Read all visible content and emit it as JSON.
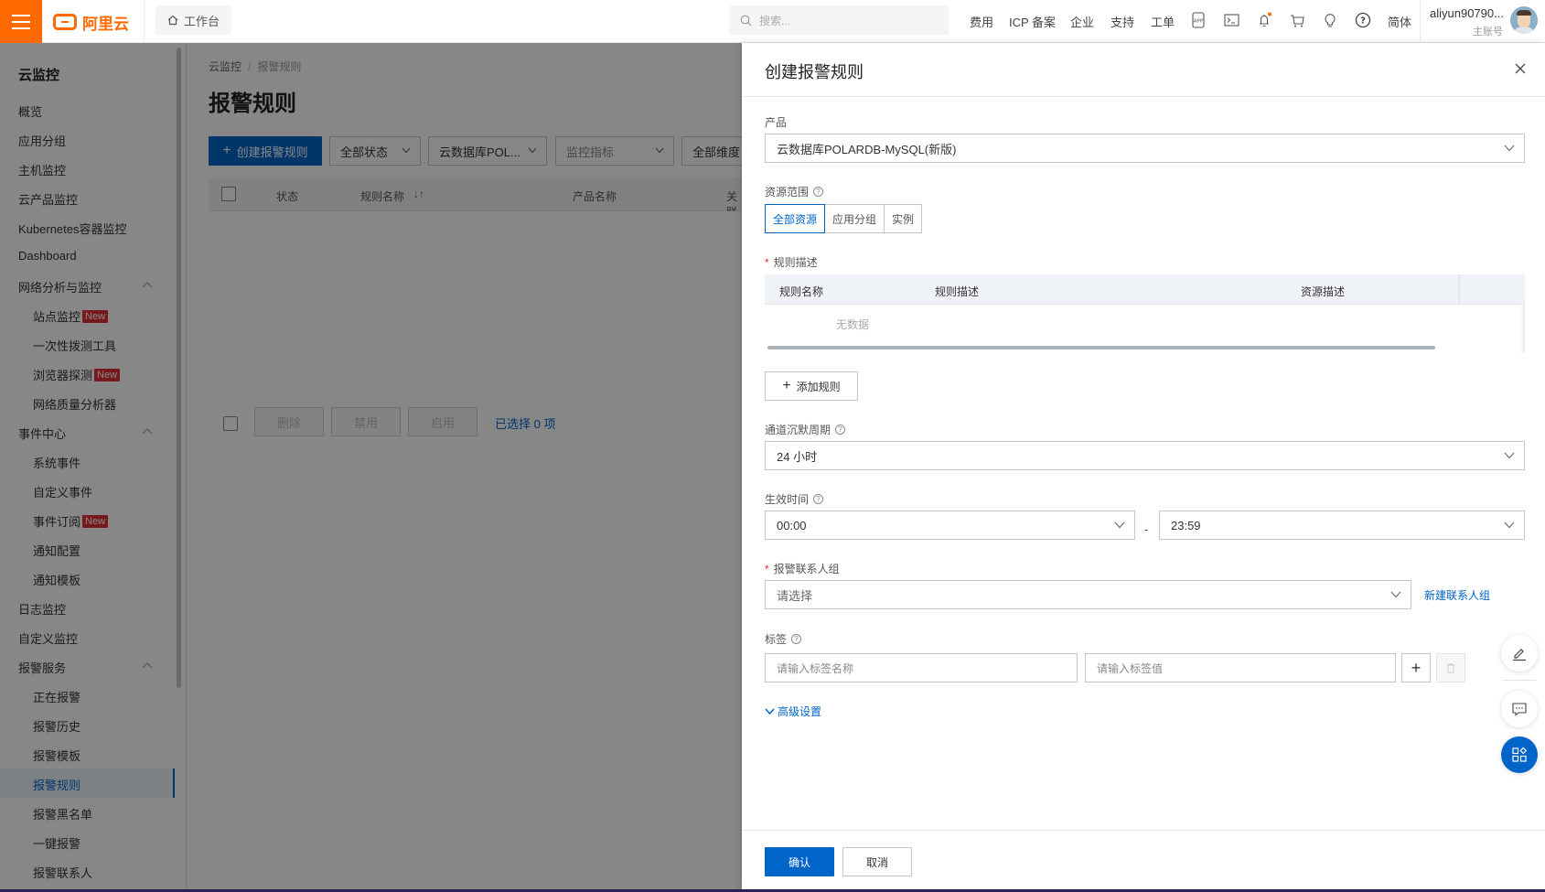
{
  "topbar": {
    "logo_text": "阿里云",
    "workbench": "工作台",
    "search_placeholder": "搜索...",
    "links": [
      "费用",
      "ICP 备案",
      "企业",
      "支持",
      "工单"
    ],
    "icons": [
      "app-icon",
      "terminal-icon",
      "bell-icon",
      "cart-icon",
      "lightbulb-icon",
      "help-icon"
    ],
    "language": "简体",
    "user_name": "aliyun90790...",
    "user_role": "主账号",
    "notification_dot_color": "#ff6a00",
    "brand_color": "#ff6a00"
  },
  "sidebar": {
    "title": "云监控",
    "items": [
      {
        "label": "概览",
        "level": 1
      },
      {
        "label": "应用分组",
        "level": 1
      },
      {
        "label": "主机监控",
        "level": 1
      },
      {
        "label": "云产品监控",
        "level": 1
      },
      {
        "label": "Kubernetes容器监控",
        "level": 1
      },
      {
        "label": "Dashboard",
        "level": 1
      },
      {
        "label": "网络分析与监控",
        "level": 1,
        "expanded": true
      },
      {
        "label": "站点监控",
        "level": 2,
        "badge": "New"
      },
      {
        "label": "一次性拨测工具",
        "level": 2
      },
      {
        "label": "浏览器探测",
        "level": 2,
        "badge": "New"
      },
      {
        "label": "网络质量分析器",
        "level": 2
      },
      {
        "label": "事件中心",
        "level": 1,
        "expanded": true
      },
      {
        "label": "系统事件",
        "level": 2
      },
      {
        "label": "自定义事件",
        "level": 2
      },
      {
        "label": "事件订阅",
        "level": 2,
        "badge": "New"
      },
      {
        "label": "通知配置",
        "level": 2
      },
      {
        "label": "通知模板",
        "level": 2
      },
      {
        "label": "日志监控",
        "level": 1
      },
      {
        "label": "自定义监控",
        "level": 1
      },
      {
        "label": "报警服务",
        "level": 1,
        "expanded": true
      },
      {
        "label": "正在报警",
        "level": 2
      },
      {
        "label": "报警历史",
        "level": 2
      },
      {
        "label": "报警模板",
        "level": 2
      },
      {
        "label": "报警规则",
        "level": 2,
        "active": true
      },
      {
        "label": "报警黑名单",
        "level": 2
      },
      {
        "label": "一键报警",
        "level": 2
      },
      {
        "label": "报警联系人",
        "level": 2
      }
    ]
  },
  "main": {
    "breadcrumb": [
      "云监控",
      "报警规则"
    ],
    "title": "报警规则",
    "create_button": "创建报警规则",
    "filters": [
      "全部状态",
      "云数据库POL...",
      "监控指标",
      "全部维度"
    ],
    "table_headers": [
      "状态",
      "规则名称",
      "产品名称",
      "关联"
    ],
    "bulk_buttons": [
      "删除",
      "禁用",
      "启用"
    ],
    "selected_text": "已选择 0 项"
  },
  "drawer": {
    "title": "创建报警规则",
    "product_label": "产品",
    "product_value": "云数据库POLARDB-MySQL(新版)",
    "scope_label": "资源范围",
    "scope_options": [
      "全部资源",
      "应用分组",
      "实例"
    ],
    "scope_selected": "全部资源",
    "rule_desc_label": "规则描述",
    "rule_table_headers": [
      "规则名称",
      "规则描述",
      "资源描述"
    ],
    "rule_table_empty": "无数据",
    "add_rule_button": "添加规则",
    "silence_label": "通道沉默周期",
    "silence_value": "24 小时",
    "effective_label": "生效时间",
    "effective_start": "00:00",
    "effective_separator": "-",
    "effective_end": "23:59",
    "contact_label": "报警联系人组",
    "contact_placeholder": "请选择",
    "new_contact_link": "新建联系人组",
    "tag_label": "标签",
    "tag_name_placeholder": "请输入标签名称",
    "tag_value_placeholder": "请输入标签值",
    "advanced_link": "高级设置",
    "confirm_button": "确认",
    "cancel_button": "取消",
    "primary_color": "#0064c8"
  },
  "floating_buttons": [
    "edit-icon",
    "feedback-icon",
    "apps-icon"
  ]
}
